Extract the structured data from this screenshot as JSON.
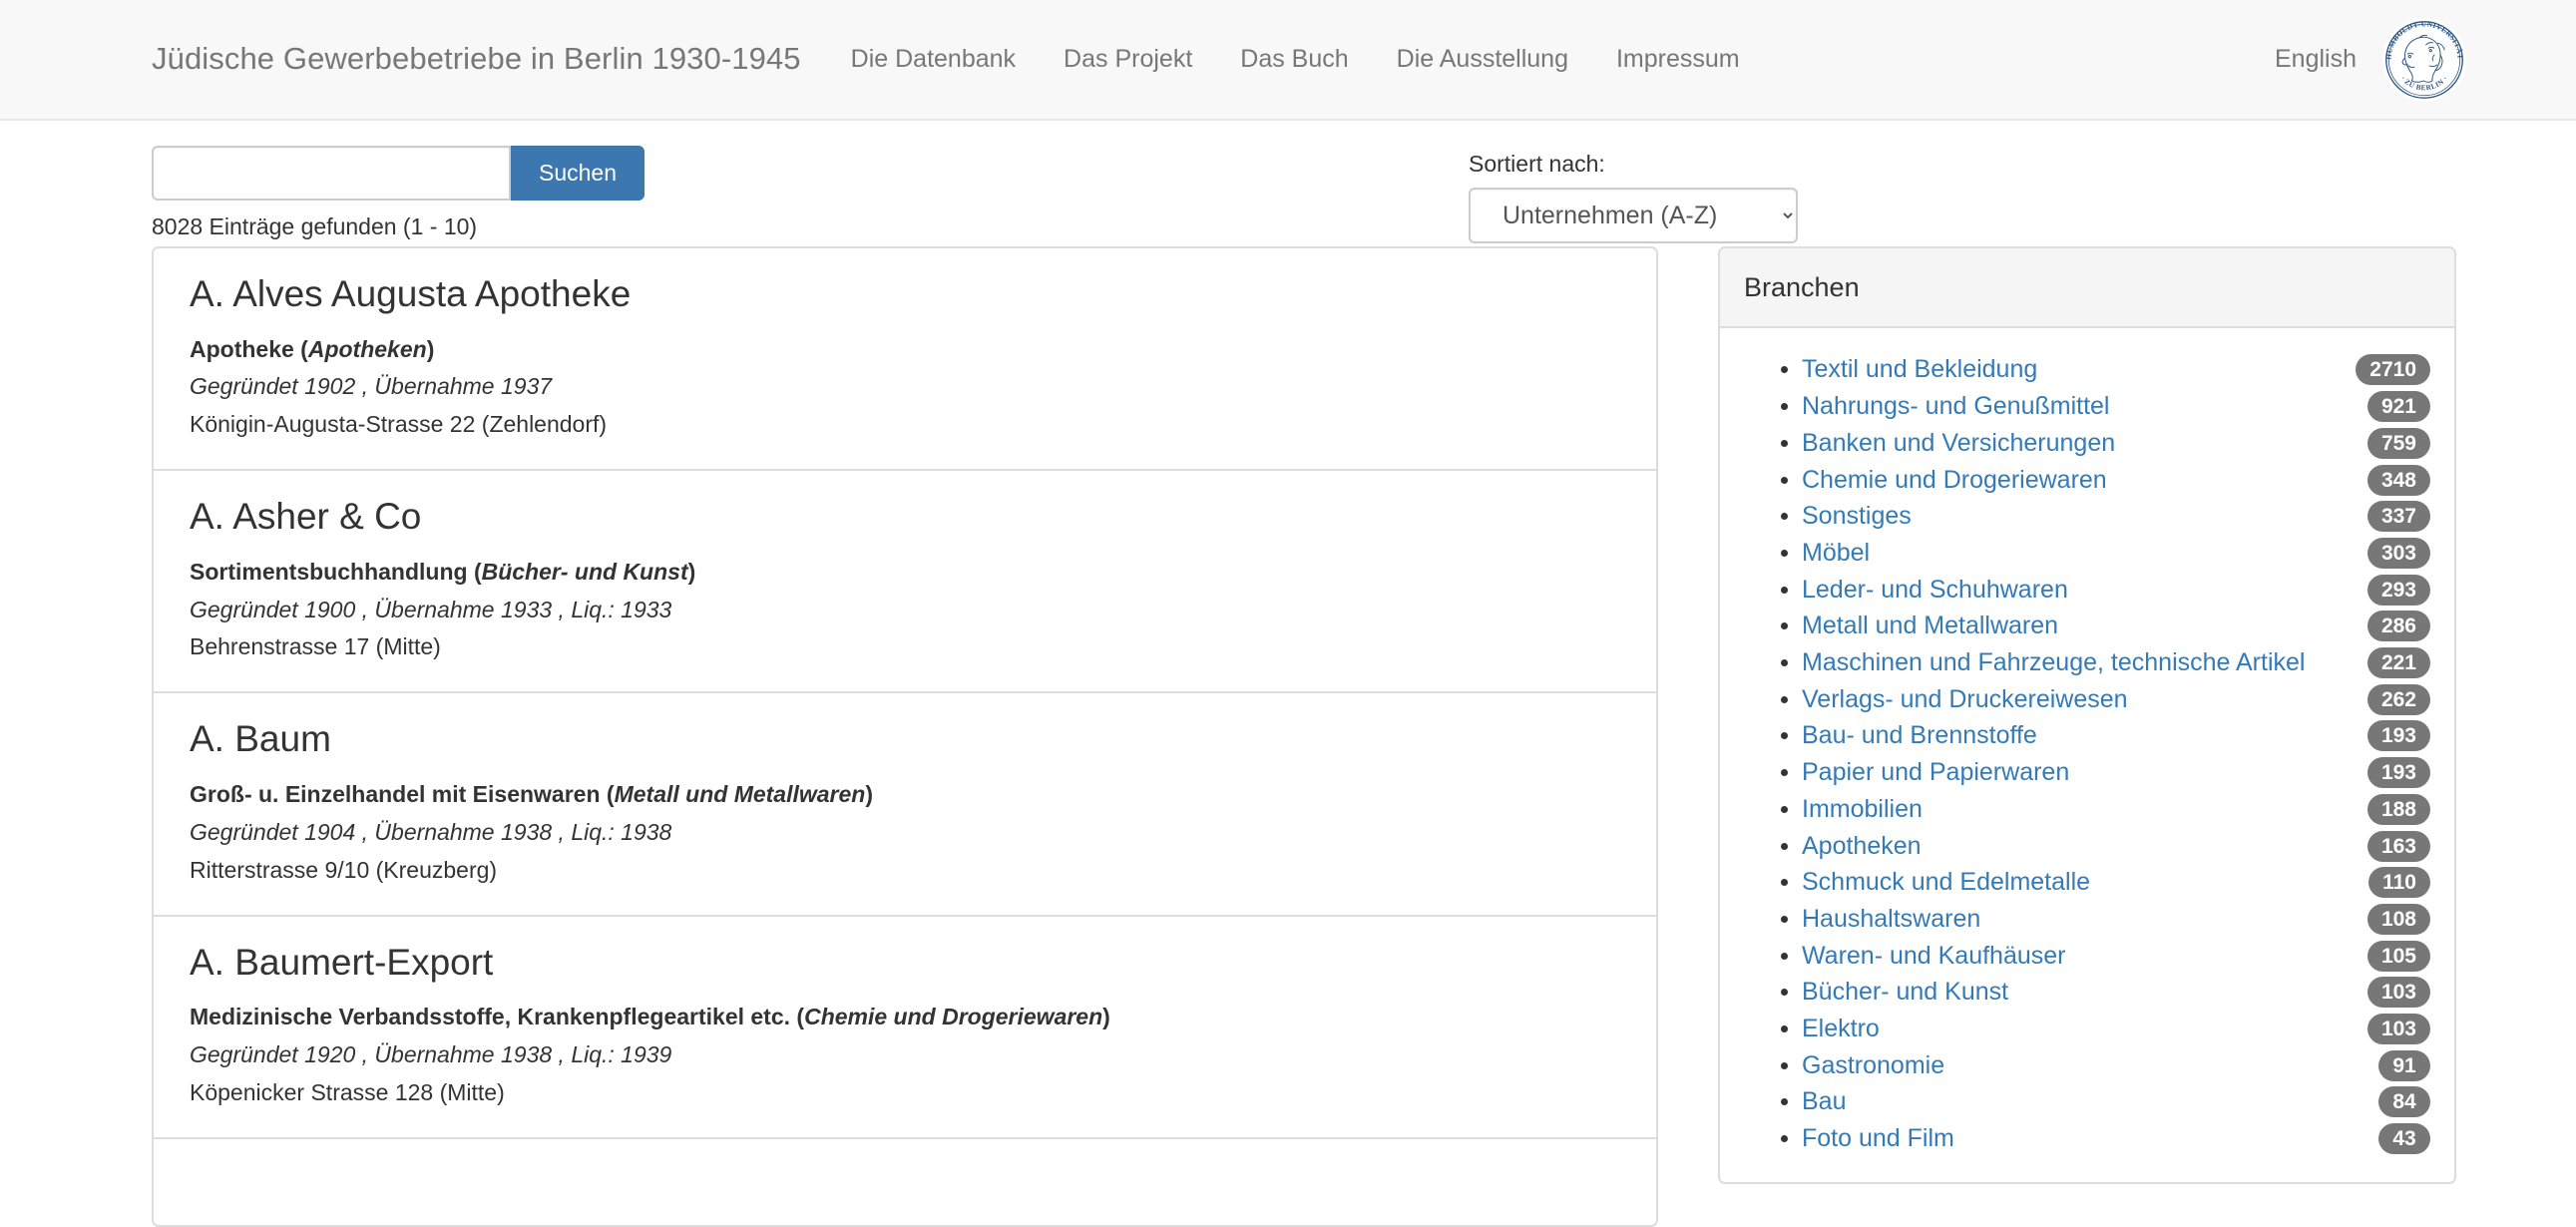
{
  "header": {
    "brand": "Jüdische Gewerbebetriebe in Berlin 1930-1945",
    "nav_items": [
      {
        "label": "Die Datenbank"
      },
      {
        "label": "Das Projekt"
      },
      {
        "label": "Das Buch"
      },
      {
        "label": "Die Ausstellung"
      },
      {
        "label": "Impressum"
      }
    ],
    "language_link": "English",
    "logo_alt": "Humboldt-Universität zu Berlin",
    "logo_text_outer": "HUMBOLDT-UNIVERSITÄT",
    "logo_text_inner": "ZU BERLIN",
    "logo_color": "#2a5580",
    "background": "#f8f8f8",
    "text_color": "#777777"
  },
  "search": {
    "input_value": "",
    "placeholder": "",
    "button_label": "Suchen",
    "button_color": "#3c77b0",
    "result_count_text": "8028 Einträge gefunden (1 - 10)"
  },
  "sort": {
    "label": "Sortiert nach:",
    "selected": "Unternehmen (A-Z)",
    "options": [
      "Unternehmen (A-Z)"
    ]
  },
  "results": [
    {
      "title": "A. Alves Augusta Apotheke",
      "branch_main": "Apotheke (",
      "branch_category": "Apotheken",
      "branch_close": ")",
      "dates": "Gegründet 1902 , Übernahme 1937",
      "address": "Königin-Augusta-Strasse 22 (Zehlendorf)"
    },
    {
      "title": "A. Asher & Co",
      "branch_main": "Sortimentsbuchhandlung (",
      "branch_category": "Bücher- und Kunst",
      "branch_close": ")",
      "dates": "Gegründet 1900 , Übernahme 1933 , Liq.: 1933",
      "address": "Behrenstrasse 17 (Mitte)"
    },
    {
      "title": "A. Baum",
      "branch_main": "Groß- u. Einzelhandel mit Eisenwaren (",
      "branch_category": "Metall und Metallwaren",
      "branch_close": ")",
      "dates": "Gegründet 1904 , Übernahme 1938 , Liq.: 1938",
      "address": "Ritterstrasse 9/10 (Kreuzberg)"
    },
    {
      "title": "A. Baumert-Export",
      "branch_main": "Medizinische Verbandsstoffe, Krankenpflegeartikel etc. (",
      "branch_category": "Chemie und Drogeriewaren",
      "branch_close": ")",
      "dates": "Gegründet 1920 , Übernahme 1938 , Liq.: 1939",
      "address": "Köpenicker Strasse 128 (Mitte)"
    }
  ],
  "sidebar": {
    "panel_title": "Branchen",
    "badge_color": "#777777",
    "link_color": "#337ab7",
    "branches": [
      {
        "label": "Textil und Bekleidung",
        "count": "2710"
      },
      {
        "label": "Nahrungs- und Genußmittel",
        "count": "921"
      },
      {
        "label": "Banken und Versicherungen",
        "count": "759"
      },
      {
        "label": "Chemie und Drogeriewaren",
        "count": "348"
      },
      {
        "label": "Sonstiges",
        "count": "337"
      },
      {
        "label": "Möbel",
        "count": "303"
      },
      {
        "label": "Leder- und Schuhwaren",
        "count": "293"
      },
      {
        "label": "Metall und Metallwaren",
        "count": "286"
      },
      {
        "label": "Maschinen und Fahrzeuge, technische Artikel",
        "count": "221"
      },
      {
        "label": "Verlags- und Druckereiwesen",
        "count": "262"
      },
      {
        "label": "Bau- und Brennstoffe",
        "count": "193"
      },
      {
        "label": "Papier und Papierwaren",
        "count": "193"
      },
      {
        "label": "Immobilien",
        "count": "188"
      },
      {
        "label": "Apotheken",
        "count": "163"
      },
      {
        "label": "Schmuck und Edelmetalle",
        "count": "110"
      },
      {
        "label": "Haushaltswaren",
        "count": "108"
      },
      {
        "label": "Waren- und Kaufhäuser",
        "count": "105"
      },
      {
        "label": "Bücher- und Kunst",
        "count": "103"
      },
      {
        "label": "Elektro",
        "count": "103"
      },
      {
        "label": "Gastronomie",
        "count": "91"
      },
      {
        "label": "Bau",
        "count": "84"
      },
      {
        "label": "Foto und Film",
        "count": "43"
      }
    ]
  }
}
